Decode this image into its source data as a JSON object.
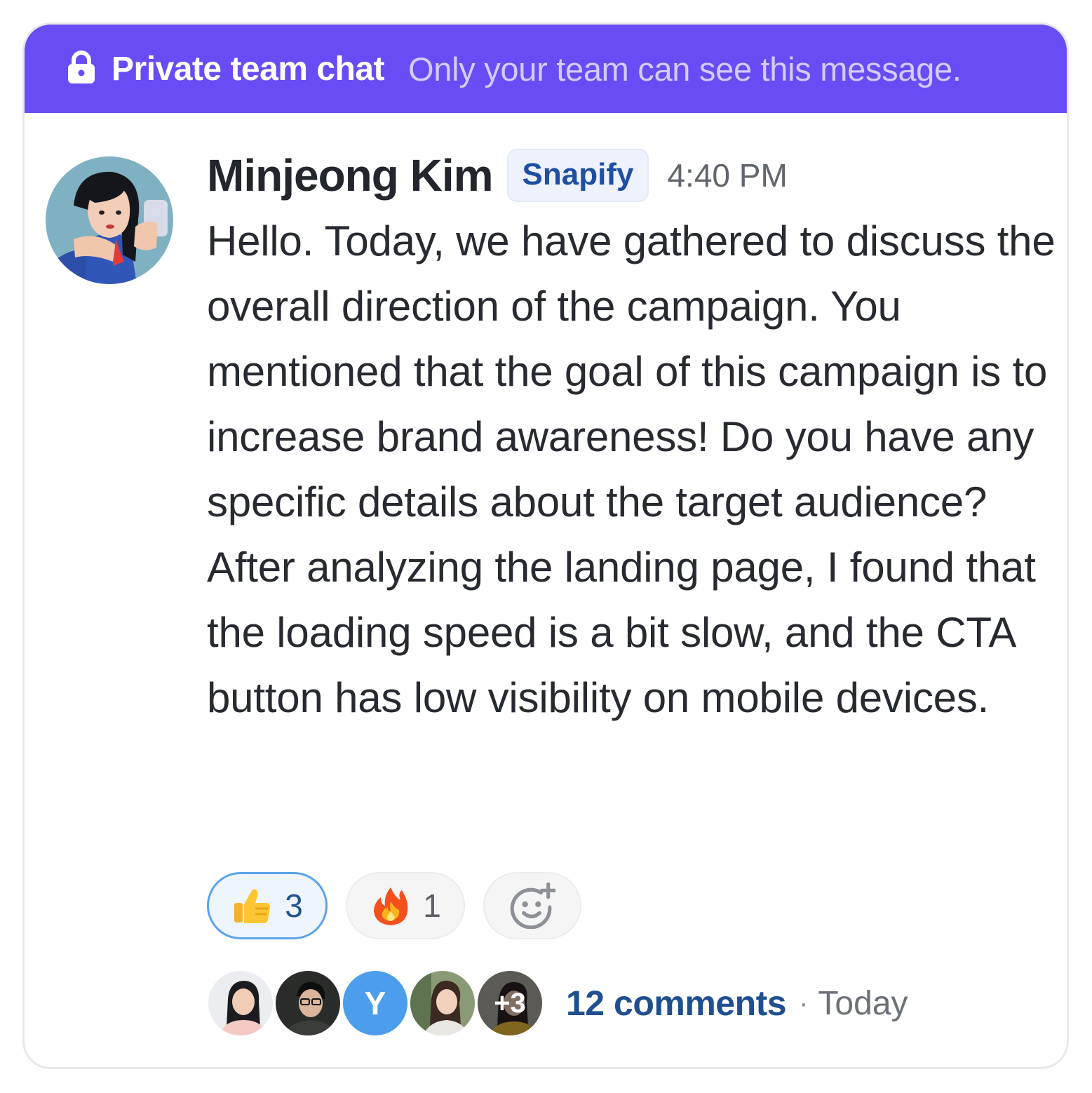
{
  "banner": {
    "icon": "lock-icon",
    "title": "Private team chat",
    "subtitle": "Only your team can see this message.",
    "color": "#6a4cf5"
  },
  "message": {
    "author": "Minjeong Kim",
    "org": "Snapify",
    "time": "4:40 PM",
    "body": "Hello. Today, we have gathered to discuss the overall direction of the campaign. You mentioned that the goal of this campaign is to increase brand awareness! Do you have any specific details about the target audience? After analyzing the landing page, I found that the loading speed is a bit slow, and the CTA button has low visibility on mobile devices."
  },
  "reactions": [
    {
      "emoji": "thumbs-up-icon",
      "count": "3",
      "selected": true
    },
    {
      "emoji": "fire-icon",
      "count": "1",
      "selected": false
    }
  ],
  "add_reaction_icon": "add-emoji-icon",
  "participants": {
    "initial": "Y",
    "more": "+3"
  },
  "comments": {
    "label": "12 comments",
    "separator": "·",
    "when": "Today"
  }
}
